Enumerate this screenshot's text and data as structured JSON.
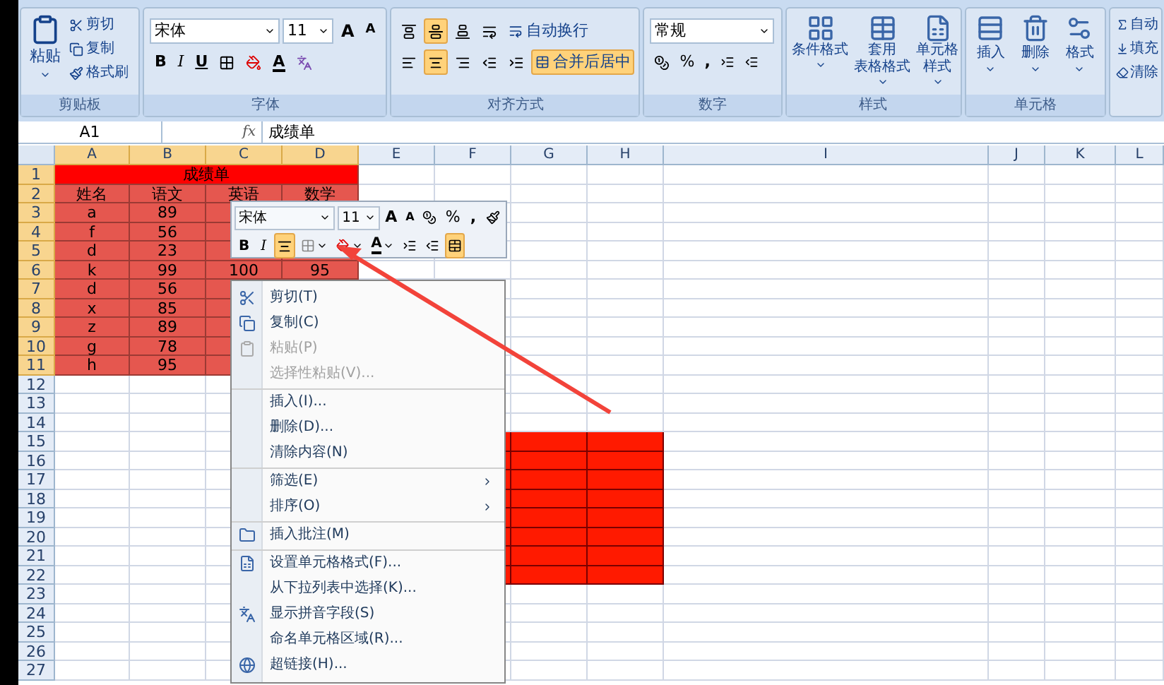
{
  "ribbon": {
    "clipboard": {
      "label": "剪贴板",
      "paste": "粘贴",
      "actions": [
        "剪切",
        "复制",
        "格式刷"
      ]
    },
    "font": {
      "label": "字体",
      "font_name": "宋体",
      "font_size": "11",
      "grow": "A",
      "shrink": "A",
      "bold": "B",
      "italic": "I",
      "underline": "U",
      "font_color": "A"
    },
    "alignment": {
      "label": "对齐方式",
      "vertical": [
        {
          "selected": false
        },
        {
          "selected": true
        },
        {
          "selected": false
        }
      ],
      "horizontal": [
        {
          "selected": false
        },
        {
          "selected": true
        },
        {
          "selected": false
        }
      ],
      "wrap_text": {
        "label": "自动换行",
        "selected": false
      },
      "merge": {
        "label": "合并后居中",
        "selected": true
      }
    },
    "number": {
      "label": "数字",
      "format": "常规",
      "percent": "%",
      "comma": ","
    },
    "styles": {
      "label": "样式",
      "buttons": [
        {
          "lines": [
            "条件格式"
          ]
        },
        {
          "lines": [
            "套用",
            "表格格式"
          ]
        },
        {
          "lines": [
            "单元格",
            "样式"
          ]
        }
      ]
    },
    "cells": {
      "label": "单元格",
      "buttons": [
        "插入",
        "删除",
        "格式"
      ]
    },
    "editing": {
      "buttons": [
        "自动",
        "填充",
        "清除"
      ]
    }
  },
  "formula_bar": {
    "name_box": "A1",
    "fx": "fx",
    "value": "成绩单"
  },
  "sheet": {
    "columns": [
      {
        "label": "A",
        "selected": true
      },
      {
        "label": "B",
        "selected": true
      },
      {
        "label": "C",
        "selected": true
      },
      {
        "label": "D",
        "selected": true
      },
      {
        "label": "E",
        "selected": false
      },
      {
        "label": "F",
        "selected": false
      },
      {
        "label": "G",
        "selected": false
      },
      {
        "label": "H",
        "selected": false
      },
      {
        "label": "I",
        "selected": false
      },
      {
        "label": "J",
        "selected": false
      },
      {
        "label": "K",
        "selected": false
      },
      {
        "label": "L",
        "selected": false
      }
    ],
    "rows": [
      {
        "label": "1",
        "selected": true
      },
      {
        "label": "2",
        "selected": true
      },
      {
        "label": "3",
        "selected": true
      },
      {
        "label": "4",
        "selected": true
      },
      {
        "label": "5",
        "selected": true
      },
      {
        "label": "6",
        "selected": true
      },
      {
        "label": "7",
        "selected": true
      },
      {
        "label": "8",
        "selected": true
      },
      {
        "label": "9",
        "selected": true
      },
      {
        "label": "10",
        "selected": true
      },
      {
        "label": "11",
        "selected": true
      },
      {
        "label": "12",
        "selected": false
      },
      {
        "label": "13",
        "selected": false
      },
      {
        "label": "14",
        "selected": false
      },
      {
        "label": "15",
        "selected": false
      },
      {
        "label": "16",
        "selected": false
      },
      {
        "label": "17",
        "selected": false
      },
      {
        "label": "18",
        "selected": false
      },
      {
        "label": "19",
        "selected": false
      },
      {
        "label": "20",
        "selected": false
      },
      {
        "label": "21",
        "selected": false
      },
      {
        "label": "22",
        "selected": false
      },
      {
        "label": "23",
        "selected": false
      },
      {
        "label": "24",
        "selected": false
      },
      {
        "label": "25",
        "selected": false
      },
      {
        "label": "26",
        "selected": false
      },
      {
        "label": "27",
        "selected": false
      }
    ],
    "title": "成绩单",
    "headers": [
      "姓名",
      "语文",
      "英语",
      "数学"
    ],
    "records": [
      {
        "name": "a",
        "chinese": "89"
      },
      {
        "name": "f",
        "chinese": "56"
      },
      {
        "name": "d",
        "chinese": "23"
      },
      {
        "name": "k",
        "chinese": "99",
        "english": "100",
        "math": "95"
      },
      {
        "name": "d",
        "chinese": "56"
      },
      {
        "name": "x",
        "chinese": "85"
      },
      {
        "name": "z",
        "chinese": "89"
      },
      {
        "name": "g",
        "chinese": "78"
      },
      {
        "name": "h",
        "chinese": "95"
      }
    ]
  },
  "mini_toolbar": {
    "font_name": "宋体",
    "font_size": "11",
    "grow": "A",
    "shrink": "A",
    "percent": "%",
    "comma": ",",
    "bold": "B",
    "italic": "I",
    "font_color": "A",
    "center": {
      "selected": true
    },
    "merge": {
      "selected": true
    }
  },
  "context_menu": {
    "items": [
      {
        "label": "剪切(T)",
        "disabled": false,
        "submenu": false,
        "separator_before": false
      },
      {
        "label": "复制(C)",
        "disabled": false,
        "submenu": false,
        "separator_before": false
      },
      {
        "label": "粘贴(P)",
        "disabled": true,
        "submenu": false,
        "separator_before": false
      },
      {
        "label": "选择性粘贴(V)...",
        "disabled": true,
        "submenu": false,
        "separator_before": false
      },
      {
        "label": "插入(I)...",
        "disabled": false,
        "submenu": false,
        "separator_before": true
      },
      {
        "label": "删除(D)...",
        "disabled": false,
        "submenu": false,
        "separator_before": false
      },
      {
        "label": "清除内容(N)",
        "disabled": false,
        "submenu": false,
        "separator_before": false
      },
      {
        "label": "筛选(E)",
        "disabled": false,
        "submenu": true,
        "separator_before": true
      },
      {
        "label": "排序(O)",
        "disabled": false,
        "submenu": true,
        "separator_before": false
      },
      {
        "label": "插入批注(M)",
        "disabled": false,
        "submenu": false,
        "separator_before": true
      },
      {
        "label": "设置单元格格式(F)...",
        "disabled": false,
        "submenu": false,
        "separator_before": true
      },
      {
        "label": "从下拉列表中选择(K)...",
        "disabled": false,
        "submenu": false,
        "separator_before": false
      },
      {
        "label": "显示拼音字段(S)",
        "disabled": false,
        "submenu": false,
        "separator_before": false
      },
      {
        "label": "命名单元格区域(R)...",
        "disabled": false,
        "submenu": false,
        "separator_before": false
      },
      {
        "label": "超链接(H)...",
        "disabled": false,
        "submenu": false,
        "separator_before": false
      }
    ]
  }
}
